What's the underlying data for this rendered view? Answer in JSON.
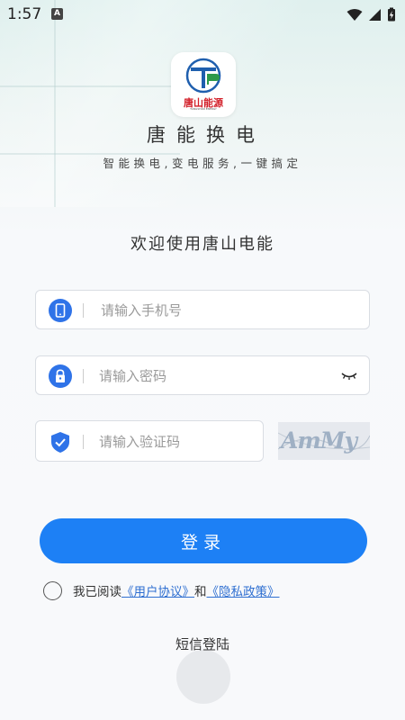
{
  "status_bar": {
    "time": "1:57",
    "notification_letter": "A"
  },
  "logo": {
    "text": "唐山能源",
    "subtext": "TANGSHAN ENERGY"
  },
  "app": {
    "title": "唐能换电",
    "slogan": "智能换电,变电服务,一键搞定"
  },
  "welcome": "欢迎使用唐山电能",
  "form": {
    "phone_placeholder": "请输入手机号",
    "phone_value": "",
    "password_placeholder": "请输入密码",
    "password_value": "",
    "code_placeholder": "请输入验证码",
    "code_value": "",
    "captcha_text": "AmMy"
  },
  "login_button": "登录",
  "agreement": {
    "prefix": "我已阅读",
    "user_agreement": "《用户协议》",
    "and": "和",
    "privacy_policy": "《隐私政策》"
  },
  "sms_login": "短信登陆",
  "colors": {
    "primary": "#1d80f5",
    "icon_blue": "#2f73e8",
    "logo_red": "#d3202a"
  }
}
